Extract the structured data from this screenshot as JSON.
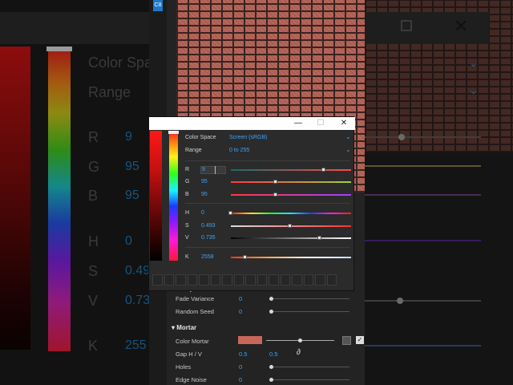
{
  "picker": {
    "color_space_label": "Color Space",
    "color_space_value": "Screen (sRGB)",
    "range_label": "Range",
    "range_value": "0 to 255",
    "channels": [
      {
        "label": "R",
        "value": "9",
        "level": 0.77
      },
      {
        "label": "G",
        "value": "95",
        "level": 0.37
      },
      {
        "label": "B",
        "value": "95",
        "level": 0.37
      },
      {
        "label": "H",
        "value": "0",
        "level": 0.0
      },
      {
        "label": "S",
        "value": "0.493",
        "level": 0.49
      },
      {
        "label": "V",
        "value": "0.735",
        "level": 0.74
      },
      {
        "label": "K",
        "value": "2558",
        "level": 0.12
      }
    ],
    "titlebar": {
      "minimize": "—",
      "restore": "☐",
      "close": "✕"
    }
  },
  "properties": {
    "fade_variance_label": "Fade Variance",
    "fade_variance_value": "0",
    "random_seed_label": "Random Seed",
    "random_seed_value": "0",
    "mortar_header": "Mortar",
    "color_mortar_label": "Color Mortar",
    "gap_label": "Gap H / V",
    "gap_h_value": "0.5",
    "gap_v_value": "0.5",
    "holes_label": "Holes",
    "holes_value": "0",
    "edge_noise_label": "Edge Noise",
    "edge_noise_value": "0"
  },
  "background_zoom": {
    "color_space_label": "Color Spac",
    "range_label": "Range",
    "letters": [
      "R",
      "G",
      "B",
      "H",
      "S",
      "V",
      "K"
    ],
    "values": [
      "9",
      "95",
      "95",
      "0",
      "0.49",
      "0.73",
      "255"
    ]
  },
  "tab_marker": "C8",
  "colors": {
    "accent": "#3ea4f5",
    "mortar": "#c8665a",
    "brick": "#b5655a"
  }
}
